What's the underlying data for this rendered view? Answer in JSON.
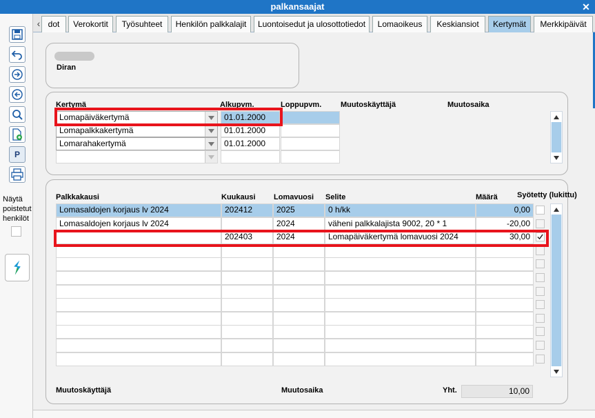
{
  "window": {
    "title": "palkansaajat",
    "close": "✕"
  },
  "toolbar": {
    "p_label": "P"
  },
  "sidebar": {
    "show_deleted_label": "Näytä poistetut henkilöt"
  },
  "tabs": [
    {
      "label": "dot"
    },
    {
      "label": "Verokortit"
    },
    {
      "label": "Työsuhteet"
    },
    {
      "label": "Henkilön palkkalajit"
    },
    {
      "label": "Luontoisedut ja ulosottotiedot"
    },
    {
      "label": "Lomaoikeus"
    },
    {
      "label": "Keskiansiot"
    },
    {
      "label": "Kertymät"
    },
    {
      "label": "Merkkipäivät"
    }
  ],
  "person": {
    "name": "Diran"
  },
  "kertyma": {
    "headers": {
      "kertyma": "Kertymä",
      "alkupvm": "Alkupvm.",
      "loppupvm": "Loppupvm.",
      "muutoskayttaja": "Muutoskäyttäjä",
      "muutosaika": "Muutosaika"
    },
    "rows": [
      {
        "type": "Lomapäiväkertymä",
        "start": "01.01.2000",
        "end": ""
      },
      {
        "type": "Lomapalkkakertymä",
        "start": "01.01.2000",
        "end": ""
      },
      {
        "type": "Lomarahakertymä",
        "start": "01.01.2000",
        "end": ""
      }
    ]
  },
  "palkka": {
    "headers": {
      "palkkakausi": "Palkkakausi",
      "kuukausi": "Kuukausi",
      "lomavuosi": "Lomavuosi",
      "selite": "Selite",
      "maara": "Määrä",
      "syotetty": "Syötetty (lukittu)"
    },
    "rows": [
      {
        "palkkakausi": "Lomasaldojen korjaus lv 2024",
        "kuukausi": "202412",
        "lomavuosi": "2025",
        "selite": "0 h/kk",
        "maara": "0,00",
        "checked": false
      },
      {
        "palkkakausi": "Lomasaldojen korjaus lv 2024",
        "kuukausi": "",
        "lomavuosi": "2024",
        "selite": "väheni palkkalajista 9002, 20 * 1",
        "maara": "-20,00",
        "checked": false
      },
      {
        "palkkakausi": "",
        "kuukausi": "202403",
        "lomavuosi": "2024",
        "selite": "Lomapäiväkertymä lomavuosi 2024",
        "maara": "30,00",
        "checked": true
      }
    ],
    "footer": {
      "muutoskayttaja": "Muutoskäyttäjä",
      "muutosaika": "Muutosaika",
      "yht_label": "Yht.",
      "yht_value": "10,00"
    }
  },
  "colors": {
    "titlebar": "#1f75c6",
    "selected": "#a7cdea",
    "highlight": "#e8141c"
  }
}
